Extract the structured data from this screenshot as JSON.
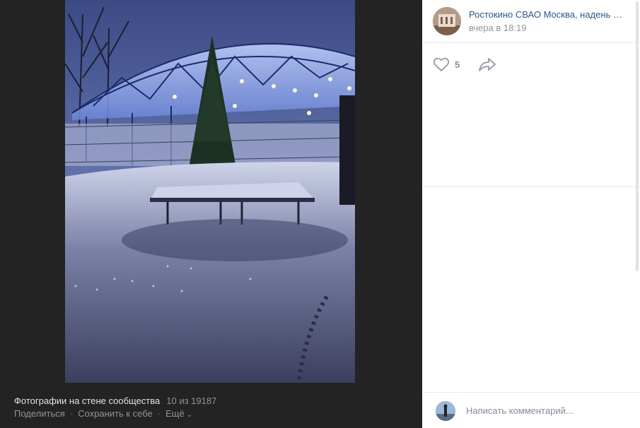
{
  "viewer": {
    "album_title": "Фотографии на стене сообщества",
    "counter": "10 из 19187",
    "actions": {
      "share": "Поделиться",
      "save": "Сохранить к себе",
      "more": "Ещё"
    }
  },
  "post": {
    "author_name": "Ростокино СВАО Москва, надень …",
    "time": "вчера в 18:19",
    "likes": "5"
  },
  "comment": {
    "placeholder": "Написать комментарий..."
  },
  "colors": {
    "link": "#2a5885",
    "muted": "#939393",
    "dark_bg": "#232323"
  }
}
